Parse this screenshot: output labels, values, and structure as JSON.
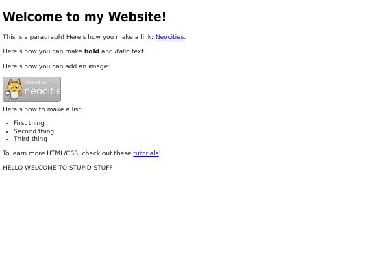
{
  "header": {
    "title": "Welcome to my Website!"
  },
  "content": {
    "paragraph1": {
      "before": "This is a paragraph! Here's how you make a link: ",
      "link": "Neocities",
      "after": "."
    },
    "paragraph2": {
      "before": "Here's how you can make ",
      "bold": "bold",
      "middle": " and ",
      "italic": "italic",
      "after": " text."
    },
    "paragraph3": "Here's how you can add an image:",
    "image": {
      "small_text": "hosted by",
      "big_text": "neocities",
      "icon": "neocities-cat-icon"
    },
    "paragraph4": "Here's how to make a list:",
    "list": [
      "First thing",
      "Second thing",
      "Third thing"
    ],
    "paragraph5": {
      "before": "To learn more HTML/CSS, check out these ",
      "link": "tutorials",
      "after": "!"
    },
    "paragraph6": "HELLO WELCOME TO STUPID STUFF"
  },
  "colors": {
    "link": "#0000ee",
    "text": "#1a1a1a",
    "background": "#ffffff"
  }
}
